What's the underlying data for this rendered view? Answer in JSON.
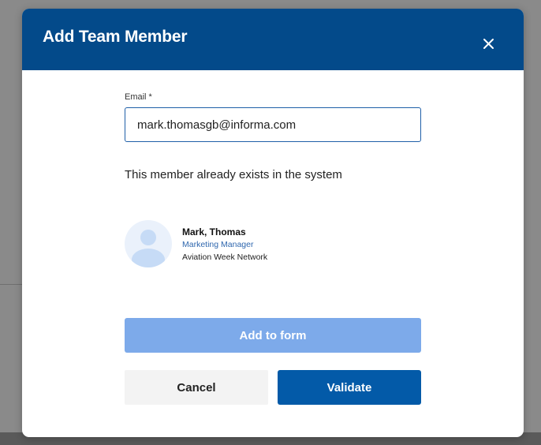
{
  "dialog": {
    "title": "Add Team Member",
    "close_icon": "close-icon"
  },
  "form": {
    "email_label": "Email *",
    "email_value": "mark.thomasgb@informa.com",
    "exists_message": "This member already exists in the system"
  },
  "member": {
    "avatar_icon": "user-avatar-icon",
    "name": "Mark, Thomas",
    "role": "Marketing Manager",
    "company": "Aviation Week Network"
  },
  "actions": {
    "add_to_form_label": "Add to form",
    "cancel_label": "Cancel",
    "validate_label": "Validate"
  },
  "colors": {
    "header": "#034a8a",
    "primary_button": "#035aa8",
    "disabled_button": "#7daaea",
    "secondary_button": "#f3f3f3",
    "role_text": "#2f67ae",
    "input_border": "#1f5fa8"
  }
}
